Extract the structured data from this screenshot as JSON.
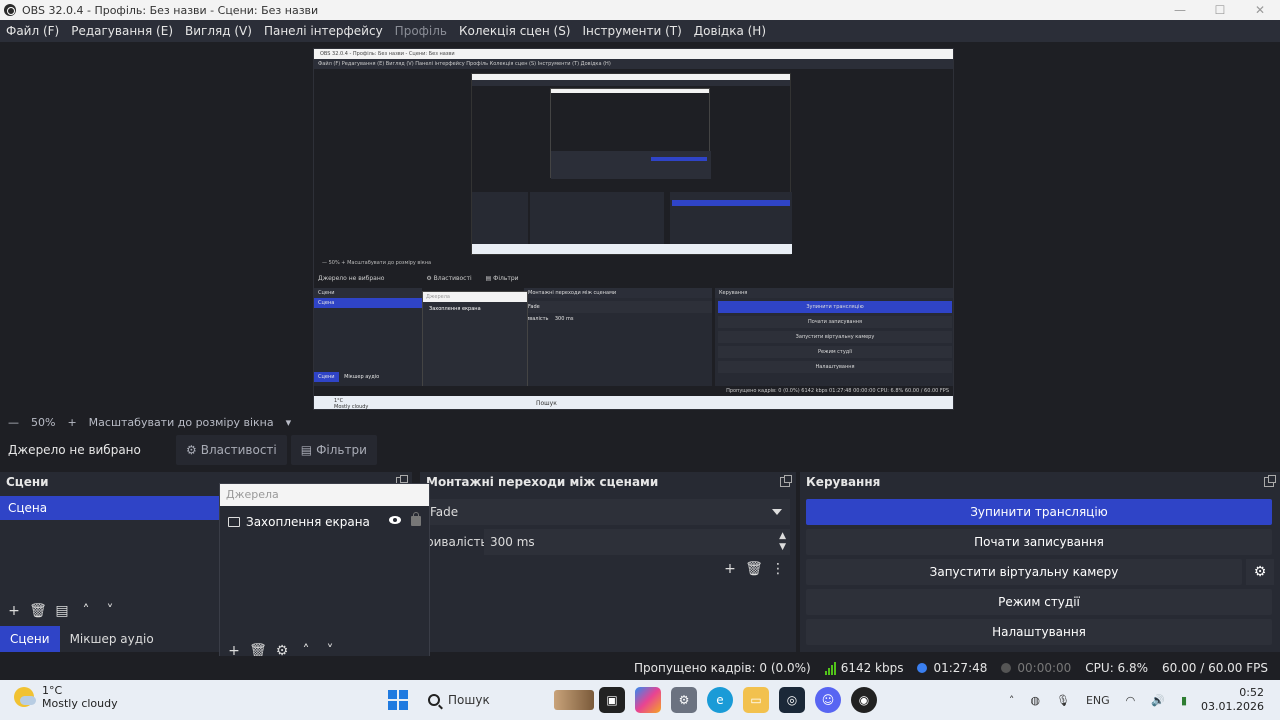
{
  "window": {
    "title": "OBS 32.0.4 - Профіль: Без назви - Сцени: Без назви",
    "controls": [
      "minimize",
      "maximize",
      "close"
    ]
  },
  "menu": [
    "Файл (F)",
    "Редагування (E)",
    "Вигляд (V)",
    "Панелі інтерфейсу",
    "Профіль",
    "Колекція сцен (S)",
    "Інструменти (T)",
    "Довідка (H)"
  ],
  "preview": {
    "inner_title": "OBS 32.0.4 - Профіль: Без назви - Сцени: Без назви",
    "inner_menu": "Файл (F)   Редагування (E)   Вигляд (V)   Панелі інтерфейсу   Профіль   Колекція сцен (S)   Інструменти (T)   Довідка (H)",
    "zoom_line": "—   50%   +   Масштабувати до розміру вікна",
    "no_source": "Джерело не вибрано",
    "props": "Властивості",
    "filters": "Фільтри",
    "scenes": "Сцени",
    "scene": "Сцена",
    "sources": "Джерела",
    "source": "Захоплення екрана",
    "transitions": "Монтажні переходи між сценами",
    "fade": "Fade",
    "duration_lbl": "ивалість",
    "duration": "300 ms",
    "controls": "Керування",
    "btn_stop": "Зупинити трансляцію",
    "btn_rec": "Почати записування",
    "btn_vcam": "Запустити віртуальну камеру",
    "btn_studio": "Режим студії",
    "btn_settings": "Налаштування",
    "tab_scenes": "Сцени",
    "tab_mixer": "Мікшер аудіо",
    "status": "Пропущено кадрів: 0 (0.0%)   6142 kbps   01:27:48   00:00:00   CPU: 6.8%   60.00 / 60.00 FPS",
    "weather_temp": "1°C",
    "weather_desc": "Mostly cloudy",
    "search": "Пошук"
  },
  "zoombar": {
    "minus": "—",
    "zoom": "50%",
    "plus": "+",
    "fit": "Масштабувати до розміру вікна"
  },
  "contextbar": {
    "no_source": "Джерело не вибрано",
    "properties": "Властивості",
    "filters": "Фільтри"
  },
  "scenes_dock": {
    "title": "Сцени",
    "items": [
      "Сцена"
    ],
    "tabs": [
      "Сцени",
      "Мікшер аудіо"
    ]
  },
  "sources_dock": {
    "title": "Джерела",
    "items": [
      {
        "label": "Захоплення екрана",
        "visible": true,
        "locked": false
      }
    ]
  },
  "transitions_dock": {
    "title": "Монтажні переходи між сценами",
    "transition": "Fade",
    "duration_label": "ривалість",
    "duration": "300 ms"
  },
  "controls_dock": {
    "title": "Керування",
    "buttons": [
      "Зупинити трансляцію",
      "Почати записування",
      "Запустити віртуальну камеру",
      "Режим студії",
      "Налаштування"
    ]
  },
  "statusbar": {
    "dropped": "Пропущено кадрів: 0 (0.0%)",
    "bitrate": "6142 kbps",
    "stream_time": "01:27:48",
    "rec_time": "00:00:00",
    "cpu": "CPU: 6.8%",
    "fps": "60.00 / 60.00 FPS"
  },
  "taskbar": {
    "weather_temp": "1°C",
    "weather_desc": "Mostly cloudy",
    "search": "Пошук",
    "lang": "ENG",
    "time": "0:52",
    "date": "03.01.2026"
  },
  "colors": {
    "accent": "#2f44c7",
    "panel": "#272a33",
    "background": "#1e1f24",
    "bitrate_green": "#52c41a"
  }
}
